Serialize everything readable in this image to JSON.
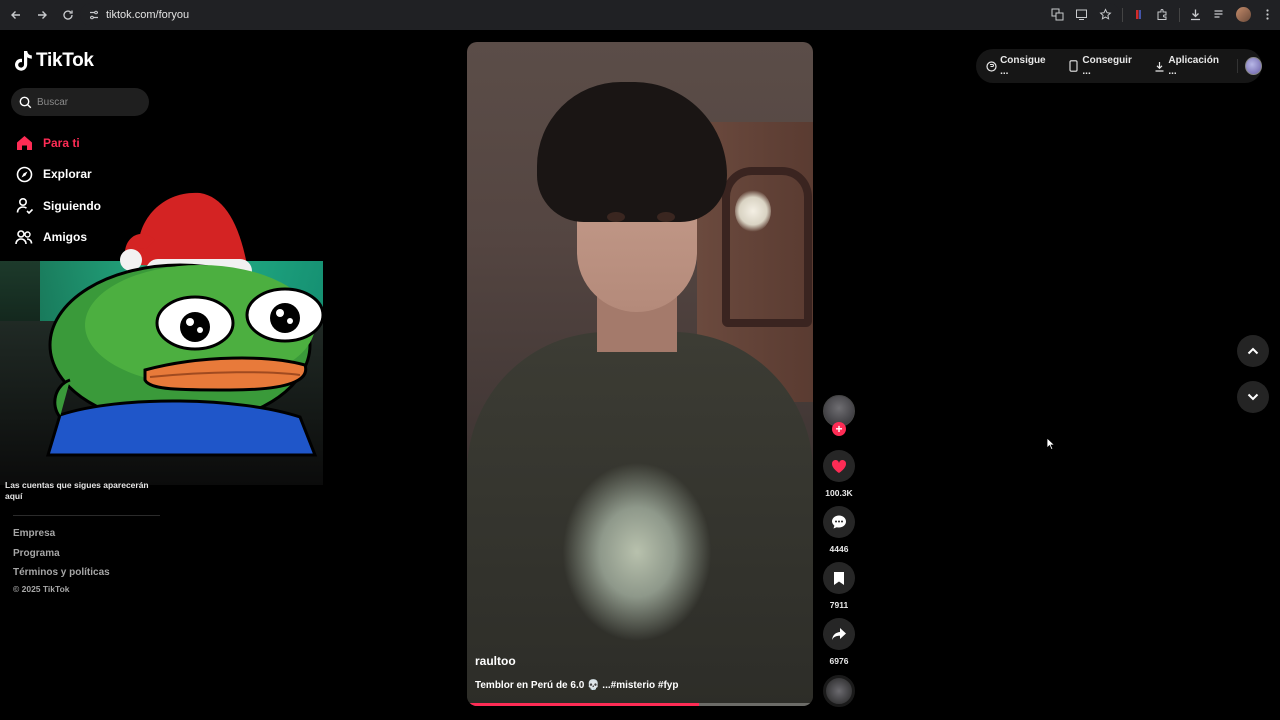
{
  "browser": {
    "url": "tiktok.com/foryou"
  },
  "brand": {
    "name": "TikTok",
    "accent": "#fe2c55"
  },
  "search": {
    "placeholder": "Buscar"
  },
  "sidebar": {
    "items": [
      {
        "label": "Para ti",
        "icon": "home-icon",
        "active": true
      },
      {
        "label": "Explorar",
        "icon": "compass-icon",
        "active": false
      },
      {
        "label": "Siguiendo",
        "icon": "following-icon",
        "active": false
      },
      {
        "label": "Amigos",
        "icon": "friends-icon",
        "active": false
      }
    ],
    "followed_note": "Las cuentas que sigues aparecerán aquí",
    "footer_links": [
      "Empresa",
      "Programa",
      "Términos y políticas"
    ],
    "copyright": "© 2025 TikTok"
  },
  "video": {
    "author": "raultoo",
    "caption": "Temblor en Perú de 6.0 💀 ...#misterio #fyp",
    "progress": 0.67
  },
  "actions": {
    "likes": "100.3K",
    "comments": "4446",
    "saves": "7911",
    "shares": "6976"
  },
  "topbar": {
    "items": [
      {
        "label": "Consigue ...",
        "icon": "coin-icon"
      },
      {
        "label": "Conseguir ...",
        "icon": "phone-icon"
      },
      {
        "label": "Aplicación ...",
        "icon": "download-icon"
      }
    ]
  }
}
